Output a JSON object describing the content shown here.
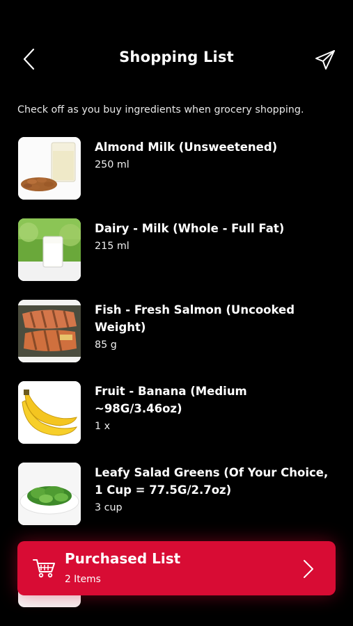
{
  "header": {
    "title": "Shopping List",
    "back_icon": "chevron-left-icon",
    "send_icon": "paper-plane-icon"
  },
  "subtitle": "Check off as you buy ingredients when grocery shopping.",
  "items": [
    {
      "name": "Almond Milk (Unsweetened)",
      "qty": "250 ml",
      "icon": "almond-milk-image"
    },
    {
      "name": "Dairy - Milk (Whole - Full Fat)",
      "qty": "215 ml",
      "icon": "milk-glass-image"
    },
    {
      "name": "Fish - Fresh Salmon (Uncooked Weight)",
      "qty": "85 g",
      "icon": "salmon-image"
    },
    {
      "name": "Fruit - Banana (Medium ~98G/3.46oz)",
      "qty": "1 x",
      "icon": "banana-image"
    },
    {
      "name": "Leafy Salad Greens (Of Your Choice, 1 Cup = 77.5G/2.7oz)",
      "qty": "3 cup",
      "icon": "salad-image"
    }
  ],
  "purchased": {
    "title": "Purchased List",
    "count": "2 Items",
    "icon": "cart-icon"
  },
  "colors": {
    "background": "#000000",
    "accent": "#d80c34",
    "text": "#ffffff"
  }
}
